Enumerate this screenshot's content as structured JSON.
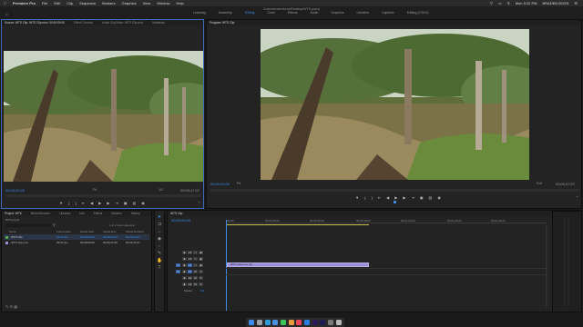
{
  "menubar": {
    "apple_icon": "apple-icon",
    "app_name": "Premiere Pro",
    "items": [
      "File",
      "Edit",
      "Clip",
      "Sequence",
      "Markers",
      "Graphics",
      "View",
      "Window",
      "Help"
    ],
    "right": {
      "clock": "Mon 9:22 PM",
      "user": "BRADEN BOSS"
    }
  },
  "workspace": {
    "doc_title": "/Users/bradenboss/Desktop/WTS.prproj",
    "tabs": [
      "Learning",
      "Assembly",
      "Editing",
      "Color",
      "Effects",
      "Audio",
      "Graphics",
      "Libraries",
      "Captions",
      "Editing (CS5.5)"
    ],
    "active_tab": "Editing"
  },
  "source_monitor": {
    "tabs": [
      "Source: WTS Clip: WTS Clip.mov: 00:00:00:00",
      "Effect Controls",
      "Audio Clip Mixer: WTS Clip.mov",
      "Metadata"
    ],
    "timecode_in": "00;00;00;00",
    "fit": "Fit",
    "zoom": "1/2",
    "timecode_out": "00;00;47;07"
  },
  "program_monitor": {
    "title": "Program: WTS Clip",
    "timecode_in": "00;00;00;00",
    "fit": "Fit",
    "zoom": "Full",
    "timecode_out": "00;00;47;07"
  },
  "project_panel": {
    "tabs": [
      "Project: WTS",
      "Media Browser",
      "Libraries",
      "Info",
      "Effects",
      "Markers",
      "History"
    ],
    "project_file": "WTS.prproj",
    "item_count": "1 of 2 items selected",
    "columns": [
      "Name",
      "Frame Rate",
      "Media Start",
      "Media End",
      "Media Duration"
    ],
    "rows": [
      {
        "name": "WTS Clip",
        "frame_rate": "29.97 fps",
        "start": "00;00;00;00",
        "end": "00;00;47;06",
        "duration": "00;00;47;07"
      },
      {
        "name": "WTS Clip.mov",
        "frame_rate": "29.97 fps",
        "start": "00;00;00;00",
        "end": "00;00;47;06",
        "duration": "00;00;47;07"
      }
    ]
  },
  "timeline": {
    "tab": "WTS Clip",
    "timecode": "00;00;00;00",
    "ruler": [
      "00;00",
      "00;00;16;00",
      "00;00;32;00",
      "00;00;48;00",
      "00;01;04;02",
      "00;01;20;02",
      "00;01;36;02"
    ],
    "video_tracks": [
      "V3",
      "V2",
      "V1"
    ],
    "audio_tracks": [
      "A1",
      "A2",
      "A3"
    ],
    "master": "Master",
    "master_value": "0.0",
    "clip_label": "WTS Clip.mov [V]"
  },
  "colors": {
    "accent_blue": "#3d8ae8",
    "clip_violet": "#9b8ed6",
    "panel_bg": "#232323",
    "app_bg": "#1a1a1a"
  },
  "dock_icons": [
    "finder-icon",
    "launchpad-icon",
    "safari-icon",
    "mail-icon",
    "messages-icon",
    "photos-icon",
    "music-icon",
    "app-store-icon",
    "premiere-icon",
    "after-effects-icon",
    "system-preferences-icon",
    "trash-icon"
  ]
}
